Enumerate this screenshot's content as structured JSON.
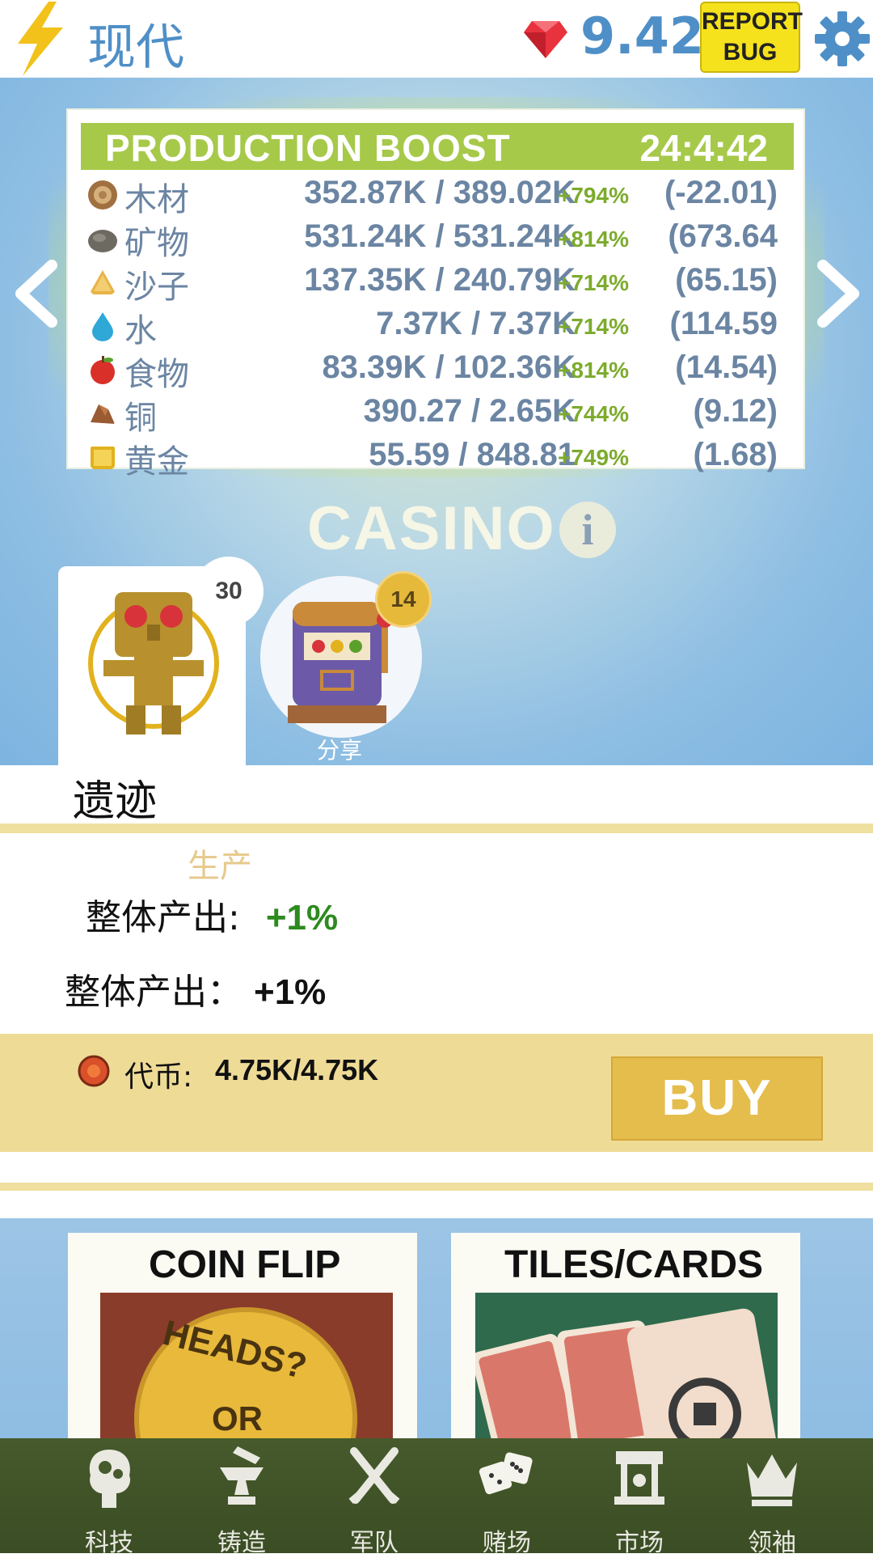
{
  "header": {
    "era": "现代",
    "gems": "9.42",
    "report_bug_line1": "REPORT",
    "report_bug_line2": "BUG"
  },
  "production": {
    "title": "PRODUCTION BOOST",
    "timer": "24:4:42",
    "resources": [
      {
        "icon": "wood-icon",
        "name": "木材",
        "amount": "352.87K / 389.02K",
        "pct": "+794%",
        "rate": "(-22.01)"
      },
      {
        "icon": "stone-icon",
        "name": "矿物",
        "amount": "531.24K / 531.24K",
        "pct": "+814%",
        "rate": "(673.64"
      },
      {
        "icon": "sand-icon",
        "name": "沙子",
        "amount": "137.35K / 240.79K",
        "pct": "+714%",
        "rate": "(65.15)"
      },
      {
        "icon": "water-icon",
        "name": "水",
        "amount": "7.37K / 7.37K",
        "pct": "+714%",
        "rate": "(114.59"
      },
      {
        "icon": "food-icon",
        "name": "食物",
        "amount": "83.39K / 102.36K",
        "pct": "+814%",
        "rate": "(14.54)"
      },
      {
        "icon": "copper-icon",
        "name": "铜",
        "amount": "390.27 / 2.65K",
        "pct": "+744%",
        "rate": "(9.12)"
      },
      {
        "icon": "gold-icon",
        "name": "黄金",
        "amount": "55.59 / 848.81",
        "pct": "+749%",
        "rate": "(1.68)"
      }
    ]
  },
  "casino": {
    "title": "CASINO",
    "idol_count": "30",
    "slot_count": "14",
    "share_label": "分享"
  },
  "relic": {
    "title": "遗迹",
    "subtitle": "生产",
    "bonus1_label": "整体产出:",
    "bonus1_value": "+1%",
    "bonus2_label": "整体产出：",
    "bonus2_value": "+1%"
  },
  "tokens": {
    "label": "代币:",
    "value": "4.75K/4.75K",
    "buy": "BUY"
  },
  "games": [
    {
      "title": "COIN FLIP",
      "coin_top": "HEADS?",
      "coin_bottom": "OR"
    },
    {
      "title": "TILES/CARDS"
    }
  ],
  "nav": [
    {
      "icon": "brain-icon",
      "label": "科技"
    },
    {
      "icon": "anvil-icon",
      "label": "铸造"
    },
    {
      "icon": "swords-icon",
      "label": "军队"
    },
    {
      "icon": "dice-icon",
      "label": "赌场"
    },
    {
      "icon": "market-icon",
      "label": "市场"
    },
    {
      "icon": "crown-icon",
      "label": "领袖"
    }
  ],
  "colors": {
    "accent_blue": "#4f8fc7",
    "boost_green": "#a6c94a",
    "token_bar": "#eedb96",
    "nav_bg": "#465a2c"
  }
}
